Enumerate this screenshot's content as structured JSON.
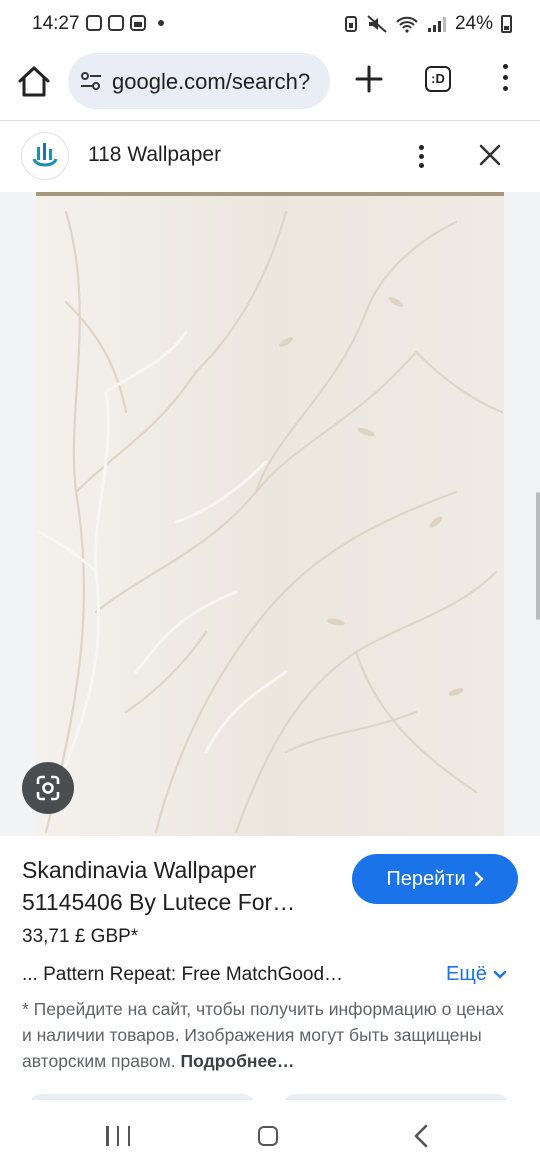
{
  "status_bar": {
    "time": "14:27",
    "battery": "24%"
  },
  "browser": {
    "url": "google.com/search?",
    "tabs_label": ":D"
  },
  "panel": {
    "site_name": "118 Wallpaper"
  },
  "result": {
    "title": "Skandinavia Wallpaper 51145406 By Lutece For…",
    "go_label": "Перейти",
    "price": "33,71 £ GBP*",
    "description": "... Pattern Repeat: Free MatchGood…",
    "more_label": "Ещё",
    "note_text": "* Перейдите на сайт, чтобы получить информацию о ценах и наличии товаров. Изображения могут быть защищены авторским правом.",
    "note_link": "Подробнее…"
  },
  "colors": {
    "accent": "#1a73e8",
    "omnibox_bg": "#e9eef6",
    "wallpaper": "#ece8e1"
  }
}
